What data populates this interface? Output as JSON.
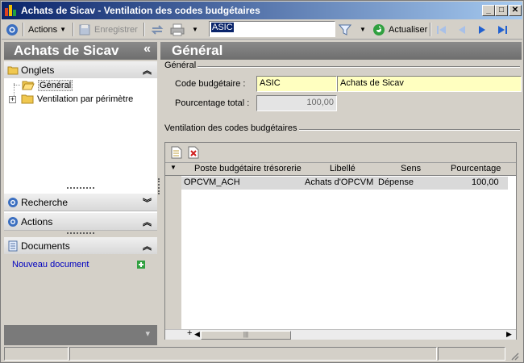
{
  "window": {
    "title": "Achats de Sicav -  Ventilation des codes budgétaires",
    "buttons": {
      "minimize": "_",
      "maximize": "□",
      "close": "✕"
    }
  },
  "toolbar": {
    "actions_label": "Actions",
    "save_label": "Enregistrer",
    "search_value": "ASIC",
    "refresh_label": "Actualiser"
  },
  "left_panel": {
    "title": "Achats de Sicav",
    "collapse_glyph": "«",
    "tabs_section": "Onglets",
    "tree": [
      {
        "label": "Général",
        "selected": true
      },
      {
        "label": "Ventilation par périmètre",
        "expandable": true,
        "expander": "+"
      }
    ],
    "search_section": "Recherche",
    "actions_section": "Actions",
    "documents_section": "Documents",
    "new_document_link": "Nouveau document",
    "bottom_glyph": "▾"
  },
  "form": {
    "header": "Général",
    "group_general": "Général",
    "code_label": "Code budgétaire :",
    "code_value": "ASIC",
    "code_description": "Achats de Sicav",
    "total_label": "Pourcentage total :",
    "total_value": "100,00",
    "group_ventilation": "Ventilation des codes budgétaires"
  },
  "grid": {
    "columns": [
      "Poste budgétaire trésorerie",
      "Libellé",
      "Sens",
      "Pourcentage"
    ],
    "rows": [
      {
        "poste": "OPCVM_ACH",
        "libelle": "Achats d'OPCVM",
        "sens": "Dépense",
        "pourcentage": "100,00"
      }
    ],
    "add_row_glyph": "+",
    "scroll_thumb_grip": "|||"
  },
  "colors": {
    "accent_blue": "#0a246a",
    "header_grey": "#7a7a7a",
    "highlight_yellow": "#ffffc0",
    "link_blue": "#0000c0"
  },
  "icons": [
    "app-icon",
    "actions-circle-icon",
    "save-icon",
    "sync-icon",
    "print-icon",
    "filter-icon",
    "refresh-icon",
    "first-icon",
    "prev-icon",
    "next-icon",
    "last-icon",
    "folder-icon",
    "new-row-icon",
    "delete-row-icon",
    "add-document-icon",
    "resize-grip-icon"
  ]
}
